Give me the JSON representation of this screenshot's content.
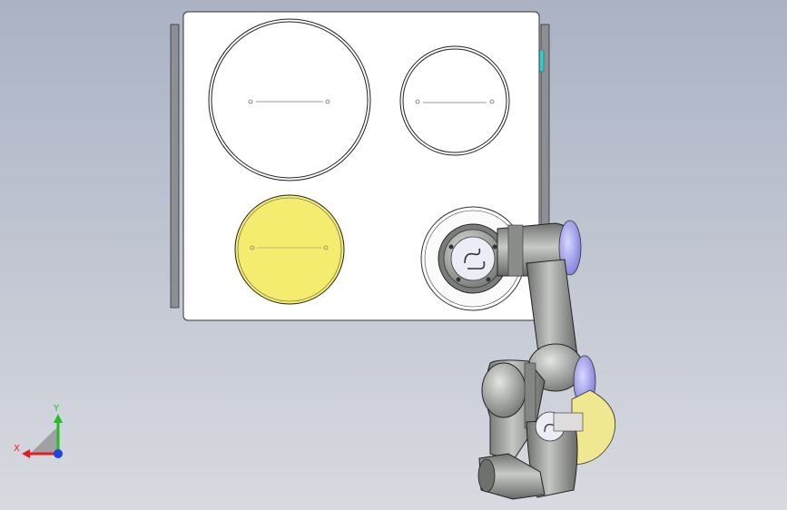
{
  "viewport": {
    "background_top": "#aab2c4",
    "background_bottom": "#d8dae0"
  },
  "table": {
    "plate_color": "#ffffff",
    "rail_color": "#8c8f94",
    "accent_color": "#3cc8c8"
  },
  "holes": [
    {
      "name": "large-circle",
      "fill": "#ffffff",
      "stroke": "#222222"
    },
    {
      "name": "medium-circle",
      "fill": "#ffffff",
      "stroke": "#222222"
    },
    {
      "name": "yellow-circle",
      "fill": "#f4ec6e",
      "stroke": "#222222"
    }
  ],
  "robot": {
    "link_color": "#9a9c9a",
    "cap_color": "#8f8de8",
    "yellow_shadow": "#f0e890"
  },
  "triad": {
    "x_label": "X",
    "y_label": "Y",
    "x_color": "#e02020",
    "y_color": "#20c020",
    "z_color": "#2040e0"
  }
}
